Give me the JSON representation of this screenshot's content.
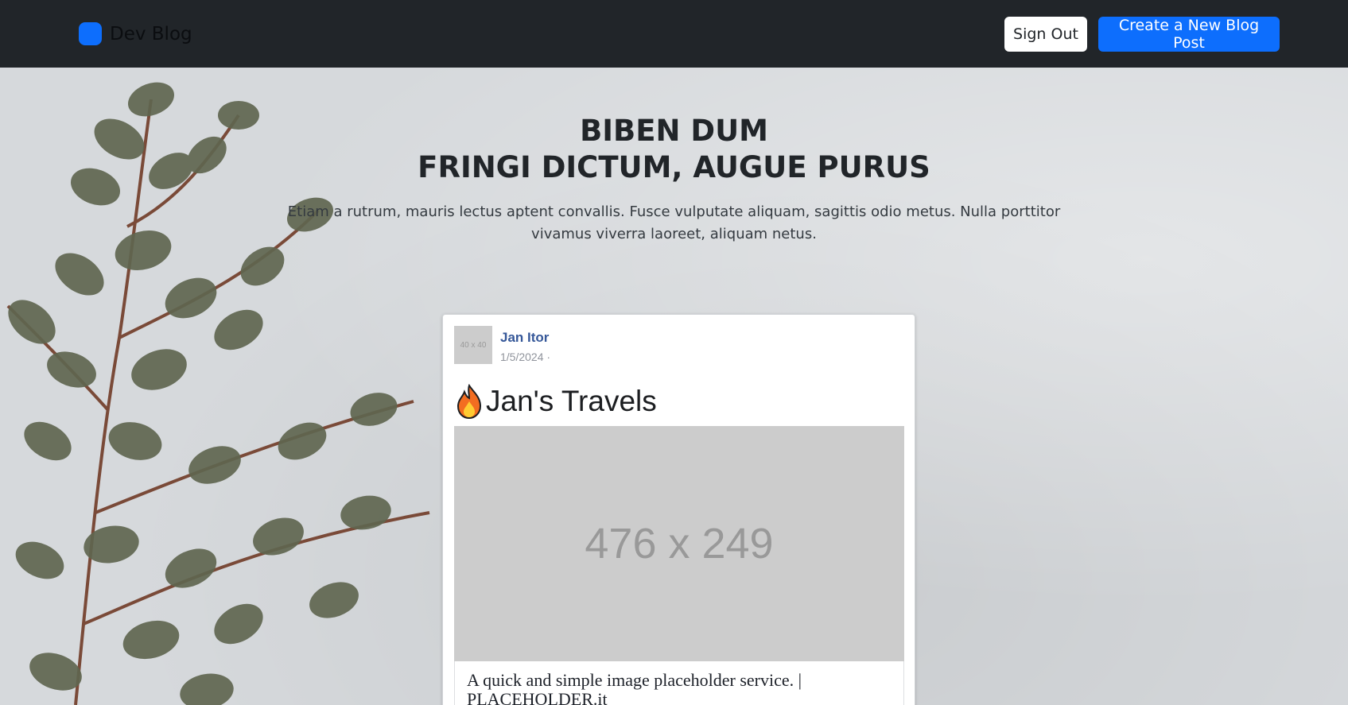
{
  "navbar": {
    "brand": "Dev Blog",
    "sign_out": "Sign Out",
    "create_post": "Create a New Blog Post"
  },
  "hero": {
    "title_line1": "BIBEN DUM",
    "title_line2": "FRINGI DICTUM, AUGUE PURUS",
    "subtitle": "Etiam a rutrum, mauris lectus aptent convallis. Fusce vulputate aliquam, sagittis odio metus. Nulla porttitor vivamus viverra laoreet, aliquam netus."
  },
  "post": {
    "avatar_text": "40 x 40",
    "author": "Jan Itor",
    "date": "1/5/2024 ·",
    "title": "Jan's Travels",
    "title_icon": "fire-icon",
    "image_text": "476 x 249",
    "link_title": "A quick and simple image placeholder service. | PLACEHOLDER.it"
  },
  "colors": {
    "navbar_bg": "#212529",
    "primary": "#0d6efd",
    "author_link": "#365899",
    "placeholder_bg": "#cccccc"
  }
}
